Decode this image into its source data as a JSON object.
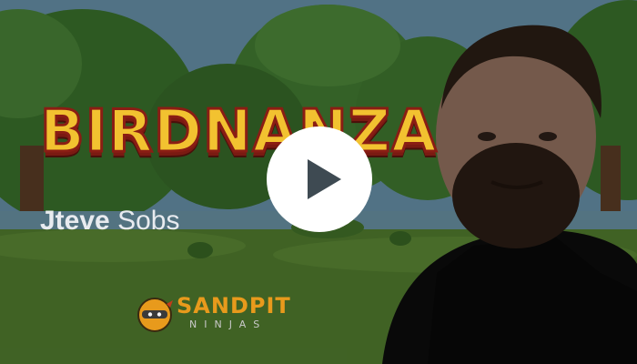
{
  "video": {
    "game_title": "BIRDNANZA",
    "presenter_first": "Jteve",
    "presenter_last": "Sobs",
    "logo_word": "SANDPIT",
    "logo_sub": "NINJAS",
    "play_icon": "play-icon"
  },
  "colors": {
    "title_fill": "#f2c230",
    "title_outline": "#8a1d14",
    "logo_orange": "#e89a1c",
    "play_button": "#ffffff",
    "overlay": "#000000"
  }
}
